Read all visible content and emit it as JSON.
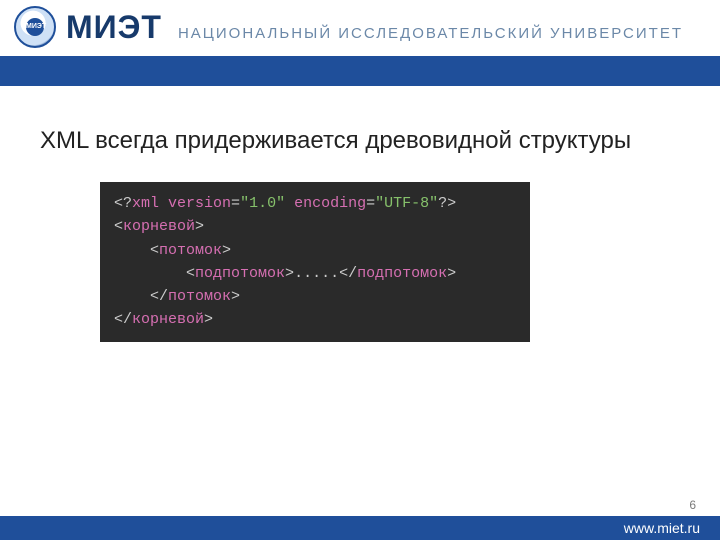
{
  "header": {
    "acronym": "МИЭТ",
    "subtitle": "НАЦИОНАЛЬНЫЙ ИССЛЕДОВАТЕЛЬСКИЙ УНИВЕРСИТЕТ",
    "logo_inner_text": "МИЭТ"
  },
  "slide": {
    "title": "XML всегда придерживается древовидной структуры",
    "page_number": "6"
  },
  "code": {
    "l1": {
      "a": "<?",
      "b": "xml version",
      "c": "=",
      "d": "\"1.0\"",
      "e": " encoding",
      "f": "=",
      "g": "\"UTF-8\"",
      "h": "?>"
    },
    "l2": {
      "a": "<",
      "b": "корневой",
      "c": ">"
    },
    "l3": {
      "indent": "    ",
      "a": "<",
      "b": "потомок",
      "c": ">"
    },
    "l4": {
      "indent": "        ",
      "a": "<",
      "b": "подпотомок",
      "c": ">",
      "d": ".....",
      "e": "</",
      "f": "подпотомок",
      "g": ">"
    },
    "l5": {
      "indent": "    ",
      "a": "</",
      "b": "потомок",
      "c": ">"
    },
    "l6": {
      "a": "</",
      "b": "корневой",
      "c": ">"
    }
  },
  "footer": {
    "url": "www.miet.ru"
  }
}
